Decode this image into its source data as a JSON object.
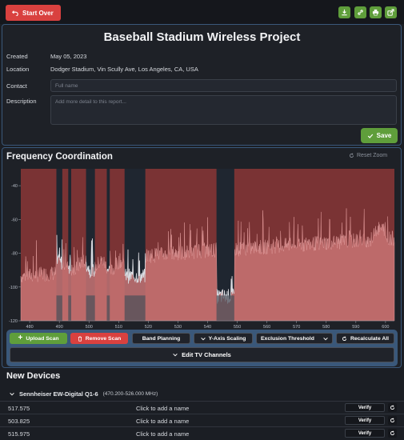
{
  "header": {
    "start_over_label": "Start Over",
    "icons": [
      "download-icon",
      "link-icon",
      "print-icon",
      "share-icon"
    ]
  },
  "project": {
    "title": "Baseball Stadium Wireless Project",
    "created_label": "Created",
    "created_value": "May 05, 2023",
    "location_label": "Location",
    "location_value": "Dodger Stadium, Vin Scully Ave, Los Angeles, CA, USA",
    "contact_label": "Contact",
    "contact_placeholder": "Full name",
    "description_label": "Description",
    "description_placeholder": "Add more detail to this report...",
    "save_label": "Save"
  },
  "frequency": {
    "title": "Frequency Coordination",
    "reset_zoom_label": "Reset Zoom"
  },
  "chart_data": {
    "type": "area",
    "xlim": [
      477,
      603
    ],
    "ylim": [
      -120,
      -30
    ],
    "x_ticks": [
      480,
      490,
      500,
      510,
      520,
      530,
      540,
      550,
      560,
      570,
      580,
      590,
      600
    ],
    "x_tick_labels": [
      "480",
      "490",
      "500",
      "510",
      "520",
      "530",
      "540",
      "550",
      "560",
      "570",
      "580",
      "590",
      "600"
    ],
    "y_ticks": [
      -40,
      -60,
      -80,
      -100,
      -120
    ],
    "y_tick_labels": [
      "-40",
      "-60",
      "-80",
      "-100",
      "-120"
    ],
    "excluded_ranges": [
      [
        477,
        489
      ],
      [
        491,
        493
      ],
      [
        494,
        499
      ],
      [
        502,
        506
      ],
      [
        507,
        512
      ],
      [
        519,
        543
      ],
      [
        549,
        603
      ]
    ],
    "open_ranges": [
      [
        489,
        491
      ],
      [
        493,
        494
      ],
      [
        499,
        502
      ],
      [
        506,
        507
      ],
      [
        512,
        519
      ],
      [
        543,
        549
      ]
    ],
    "colors": {
      "excluded": "#7a3334",
      "open": "#1f2630",
      "noise_fill": "#c97474",
      "noise_open": "#d9dde3"
    }
  },
  "toolbar": {
    "upload_label": "Upload Scan",
    "remove_label": "Remove Scan",
    "band_label": "Band Planning",
    "yaxis_label": "Y-Axis Scaling",
    "exclusion_label": "Exclusion Threshold",
    "recalc_label": "Recalculate All",
    "edit_tv_label": "Edit TV Channels"
  },
  "devices": {
    "title": "New Devices",
    "group_name": "Sennheiser EW-Digital Q1-6",
    "group_range": "(470.200-526.000 MHz)",
    "rows": [
      {
        "freq": "517.575",
        "name": "Click to add a name",
        "verify": "Verify"
      },
      {
        "freq": "503.825",
        "name": "Click to add a name",
        "verify": "Verify"
      },
      {
        "freq": "515.975",
        "name": "Click to add a name",
        "verify": "Verify"
      }
    ]
  }
}
